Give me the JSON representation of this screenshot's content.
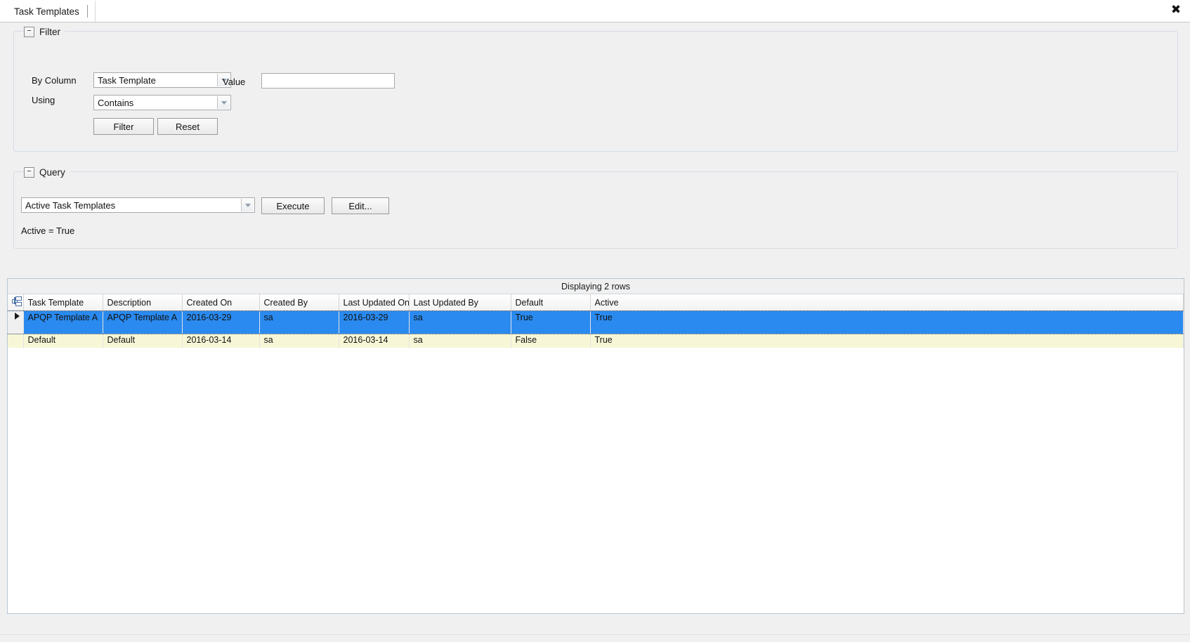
{
  "window": {
    "tab_label": "Task Templates",
    "close_label": "✖"
  },
  "filter": {
    "title": "Filter",
    "collapse_glyph": "−",
    "by_column_label": "By Column",
    "by_column_value": "Task Template",
    "value_label": "Value",
    "value_input": "",
    "value_placeholder": "",
    "using_label": "Using",
    "using_value": "Contains",
    "filter_button": "Filter",
    "reset_button": "Reset"
  },
  "query": {
    "title": "Query",
    "collapse_glyph": "−",
    "selected_query": "Active Task Templates",
    "execute_button": "Execute",
    "edit_button": "Edit...",
    "criteria_text": "Active = True"
  },
  "grid": {
    "caption": "Displaying 2 rows",
    "corner_icon": "select-all-icon",
    "columns": [
      "Task Template",
      "Description",
      "Created On",
      "Created By",
      "Last Updated On",
      "Last Updated By",
      "Default",
      "Active"
    ],
    "rows": [
      {
        "selected": true,
        "cells": [
          "APQP Template A",
          "APQP Template A",
          "2016-03-29",
          "sa",
          "2016-03-29",
          "sa",
          "True",
          "True"
        ]
      },
      {
        "selected": false,
        "cells": [
          "Default",
          "Default",
          "2016-03-14",
          "sa",
          "2016-03-14",
          "sa",
          "False",
          "True"
        ]
      }
    ]
  },
  "colors": {
    "selection_blue": "#2a8aef",
    "alt_row_yellow": "#f7f7d7",
    "window_gray": "#f0f0f0",
    "group_border": "#d6dce5"
  }
}
